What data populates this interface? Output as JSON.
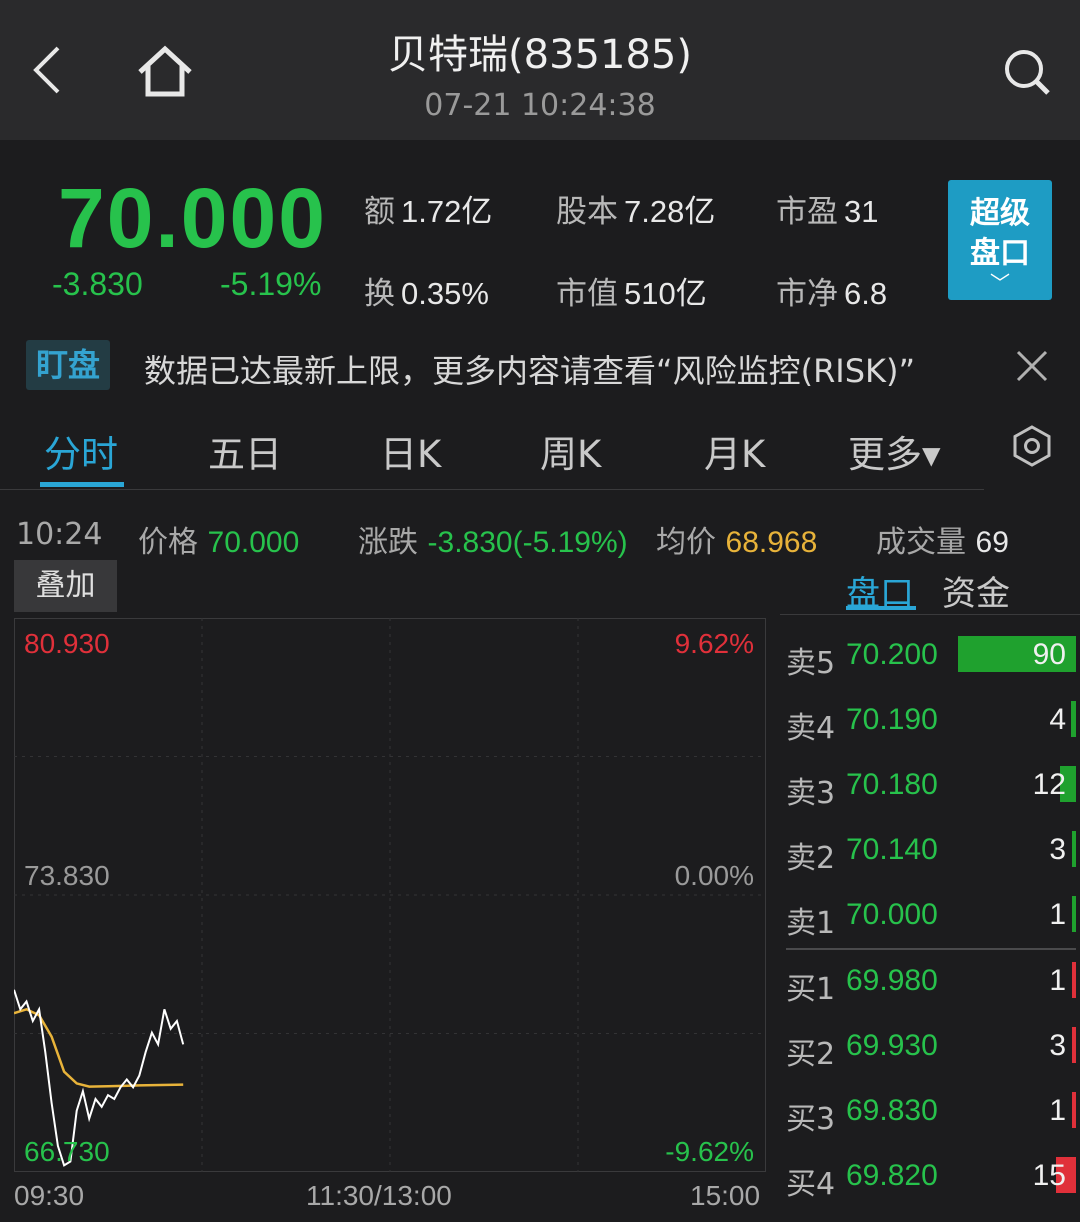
{
  "header": {
    "title": "贝特瑞(835185)",
    "datetime": "07-21 10:24:38"
  },
  "quote": {
    "price": "70.000",
    "change": "-3.830",
    "change_pct": "-5.19%",
    "stats": [
      {
        "label": "额",
        "value": "1.72亿"
      },
      {
        "label": "股本",
        "value": "7.28亿"
      },
      {
        "label": "市盈",
        "value": "31"
      },
      {
        "label": "换",
        "value": "0.35%"
      },
      {
        "label": "市值",
        "value": "510亿"
      },
      {
        "label": "市净",
        "value": "6.8"
      }
    ],
    "super_button_line1": "超级",
    "super_button_line2": "盘口",
    "super_button_chevron": "﹀"
  },
  "alert": {
    "tag": "盯盘",
    "text": "数据已达最新上限，更多内容请查看“风险监控(RISK)”"
  },
  "tabs": [
    "分时",
    "五日",
    "日K",
    "周K",
    "月K",
    "更多▾"
  ],
  "info": {
    "time": "10:24",
    "price_label": "价格",
    "price": "70.000",
    "change_label": "涨跌",
    "change": "-3.830(-5.19%)",
    "avg_label": "均价",
    "avg": "68.968",
    "volume_label": "成交量",
    "volume": "69"
  },
  "overlay_button": "叠加",
  "panel_tabs": [
    "盘口",
    "资金"
  ],
  "chart_axis": {
    "high": "80.930",
    "mid": "73.830",
    "low": "66.730",
    "high_pct": "9.62%",
    "mid_pct": "0.00%",
    "low_pct": "-9.62%",
    "time_start": "09:30",
    "time_mid": "11:30/13:00",
    "time_end": "15:00"
  },
  "chart_data": {
    "type": "line",
    "ylim": [
      66.73,
      80.93
    ],
    "series": [
      {
        "x": [
          "09:30",
          "09:32",
          "09:34",
          "09:36",
          "09:38",
          "09:40",
          "09:42",
          "09:44",
          "09:46",
          "09:48",
          "09:50",
          "09:52",
          "09:54",
          "09:56",
          "09:58",
          "10:00",
          "10:02",
          "10:04",
          "10:06",
          "10:08",
          "10:10",
          "10:12",
          "10:14",
          "10:16",
          "10:18",
          "10:20",
          "10:22",
          "10:24"
        ],
        "values": [
          71.4,
          70.9,
          71.1,
          70.6,
          70.9,
          69.8,
          68.5,
          67.4,
          66.9,
          67.0,
          68.3,
          68.8,
          68.1,
          68.6,
          68.4,
          68.7,
          68.6,
          68.9,
          69.1,
          68.9,
          69.2,
          69.8,
          70.3,
          70.0,
          70.9,
          70.4,
          70.6,
          70.0
        ]
      },
      {
        "x": [
          "09:30",
          "09:34",
          "09:38",
          "09:42",
          "09:46",
          "09:50",
          "09:54",
          "10:00",
          "10:10",
          "10:24"
        ],
        "values": [
          70.8,
          70.9,
          70.75,
          70.2,
          69.3,
          69.0,
          68.92,
          68.93,
          68.95,
          68.97
        ]
      }
    ]
  },
  "order_book": [
    {
      "side": "卖5",
      "price": "70.200",
      "volume": "90",
      "bar_ratio": 1.0,
      "type": "sell"
    },
    {
      "side": "卖4",
      "price": "70.190",
      "volume": "4",
      "bar_ratio": 0.044,
      "type": "sell"
    },
    {
      "side": "卖3",
      "price": "70.180",
      "volume": "12",
      "bar_ratio": 0.133,
      "type": "sell"
    },
    {
      "side": "卖2",
      "price": "70.140",
      "volume": "3",
      "bar_ratio": 0.033,
      "type": "sell"
    },
    {
      "side": "卖1",
      "price": "70.000",
      "volume": "1",
      "bar_ratio": 0.011,
      "type": "sell"
    },
    {
      "side": "买1",
      "price": "69.980",
      "volume": "1",
      "bar_ratio": 0.011,
      "type": "buy"
    },
    {
      "side": "买2",
      "price": "69.930",
      "volume": "3",
      "bar_ratio": 0.033,
      "type": "buy"
    },
    {
      "side": "买3",
      "price": "69.830",
      "volume": "1",
      "bar_ratio": 0.011,
      "type": "buy"
    },
    {
      "side": "买4",
      "price": "69.820",
      "volume": "15",
      "bar_ratio": 0.167,
      "type": "buy"
    }
  ],
  "colors": {
    "up_red": "#e0303a",
    "down_green": "#27c24c",
    "accent": "#2aa6d6",
    "avg_line": "#e8b33a",
    "price_line": "#ffffff"
  }
}
